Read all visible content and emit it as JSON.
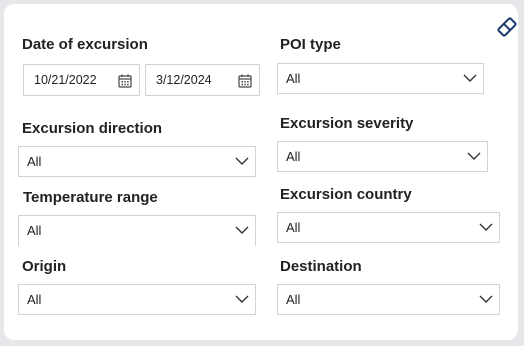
{
  "filters": {
    "date_label": "Date of excursion",
    "date_start": "10/21/2022",
    "date_end": "3/12/2024",
    "poi_type": {
      "label": "POI type",
      "value": "All"
    },
    "excursion_direction": {
      "label": "Excursion direction",
      "value": "All"
    },
    "excursion_severity": {
      "label": "Excursion severity",
      "value": "All"
    },
    "temperature_range": {
      "label": "Temperature range",
      "value": "All"
    },
    "excursion_country": {
      "label": "Excursion country",
      "value": "All"
    },
    "origin": {
      "label": "Origin",
      "value": "All"
    },
    "destination": {
      "label": "Destination",
      "value": "All"
    }
  },
  "icons": {
    "clear_filters": "eraser-icon",
    "calendar": "calendar-icon",
    "chevron": "chevron-down-icon"
  },
  "colors": {
    "border": "#d3d3d3",
    "background": "#e6e7ea",
    "card": "#ffffff",
    "icon": "#1a3a6e"
  }
}
